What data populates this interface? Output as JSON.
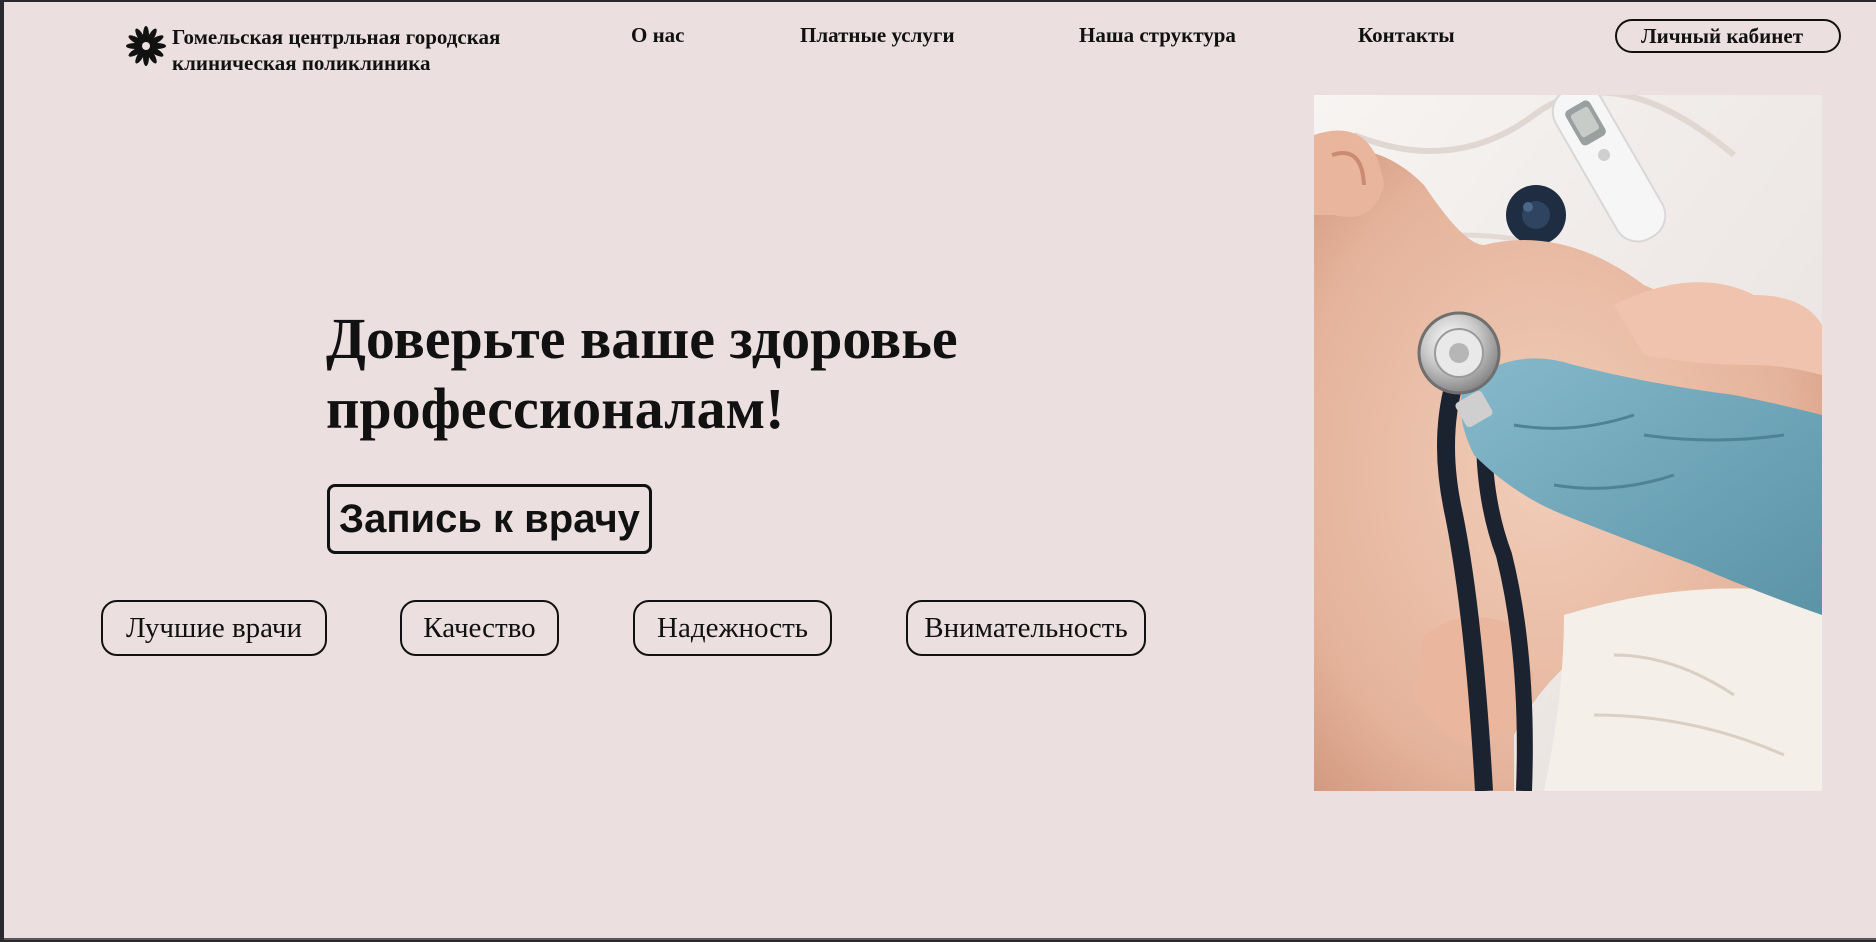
{
  "header": {
    "logo_text": "Гомельская центрльная городская клиническая поликлиника",
    "logo_icon": "flower-icon",
    "nav": [
      {
        "label": "О нас"
      },
      {
        "label": "Платные услуги"
      },
      {
        "label": "Наша структура"
      },
      {
        "label": "Контакты"
      }
    ],
    "account_label": "Личный кабинет"
  },
  "hero": {
    "title": "Доверьте ваше здоровье профессионалам!",
    "appointment_label": "Запись к врачу",
    "features": [
      {
        "label": "Лучшие врачи"
      },
      {
        "label": "Качество"
      },
      {
        "label": "Надежность"
      },
      {
        "label": "Внимательность"
      }
    ]
  },
  "colors": {
    "background": "#ebe0df",
    "text": "#111111",
    "border": "#111111",
    "glove": "#6fa5b8"
  }
}
